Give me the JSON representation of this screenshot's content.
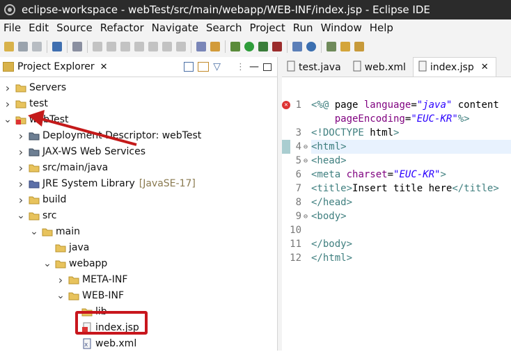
{
  "window": {
    "title": "eclipse-workspace - webTest/src/main/webapp/WEB-INF/index.jsp - Eclipse IDE"
  },
  "menu": [
    "File",
    "Edit",
    "Source",
    "Refactor",
    "Navigate",
    "Search",
    "Project",
    "Run",
    "Window",
    "Help"
  ],
  "project_explorer": {
    "tab_label": "Project Explorer",
    "tree": [
      {
        "label": "Servers",
        "indent": 0,
        "chev": "right",
        "icon": "folder-icon"
      },
      {
        "label": "test",
        "indent": 0,
        "chev": "right",
        "icon": "project-icon"
      },
      {
        "label": "webTest",
        "indent": 0,
        "chev": "down",
        "icon": "web-project-icon"
      },
      {
        "label": "Deployment Descriptor: webTest",
        "indent": 1,
        "chev": "right",
        "icon": "descriptor-icon"
      },
      {
        "label": "JAX-WS Web Services",
        "indent": 1,
        "chev": "right",
        "icon": "webservice-icon"
      },
      {
        "label": "src/main/java",
        "indent": 1,
        "chev": "right",
        "icon": "package-folder-icon"
      },
      {
        "label": "JRE System Library",
        "deco": "[JavaSE-17]",
        "indent": 1,
        "chev": "right",
        "icon": "library-icon"
      },
      {
        "label": "build",
        "indent": 1,
        "chev": "right",
        "icon": "folder-icon"
      },
      {
        "label": "src",
        "indent": 1,
        "chev": "down",
        "icon": "folder-icon"
      },
      {
        "label": "main",
        "indent": 2,
        "chev": "down",
        "icon": "folder-icon"
      },
      {
        "label": "java",
        "indent": 3,
        "chev": "none",
        "icon": "folder-icon"
      },
      {
        "label": "webapp",
        "indent": 3,
        "chev": "down",
        "icon": "folder-icon"
      },
      {
        "label": "META-INF",
        "indent": 4,
        "chev": "right",
        "icon": "folder-icon"
      },
      {
        "label": "WEB-INF",
        "indent": 4,
        "chev": "down",
        "icon": "folder-icon"
      },
      {
        "label": "lib",
        "indent": 5,
        "chev": "none",
        "icon": "folder-icon"
      },
      {
        "label": "index.jsp",
        "indent": 5,
        "chev": "none",
        "icon": "jsp-file-icon"
      },
      {
        "label": "web.xml",
        "indent": 5,
        "chev": "none",
        "icon": "xml-file-icon"
      }
    ]
  },
  "editor": {
    "tabs": [
      {
        "label": "test.java",
        "active": false,
        "icon": "java-file-icon"
      },
      {
        "label": "web.xml",
        "active": false,
        "icon": "xml-file-icon"
      },
      {
        "label": "index.jsp",
        "active": true,
        "icon": "jsp-file-icon"
      }
    ],
    "lines": [
      {
        "num": "1",
        "marker": "error",
        "text": "<%@ page language=\"java\" content"
      },
      {
        "num": "",
        "marker": "",
        "text": "    pageEncoding=\"EUC-KR\"%>"
      },
      {
        "num": "3",
        "marker": "",
        "text": "<!DOCTYPE html>"
      },
      {
        "num": "4",
        "marker": "fold",
        "text": "<html>"
      },
      {
        "num": "5",
        "marker": "fold",
        "text": "<head>"
      },
      {
        "num": "6",
        "marker": "",
        "text": "<meta charset=\"EUC-KR\">"
      },
      {
        "num": "7",
        "marker": "",
        "text": "<title>Insert title here</title>"
      },
      {
        "num": "8",
        "marker": "",
        "text": "</head>"
      },
      {
        "num": "9",
        "marker": "fold",
        "text": "<body>"
      },
      {
        "num": "10",
        "marker": "",
        "text": ""
      },
      {
        "num": "11",
        "marker": "",
        "text": "</body>"
      },
      {
        "num": "12",
        "marker": "",
        "text": "</html>"
      }
    ]
  },
  "colors": {
    "annotation_red": "#c8161d",
    "arrow_red": "#c41a1a"
  }
}
